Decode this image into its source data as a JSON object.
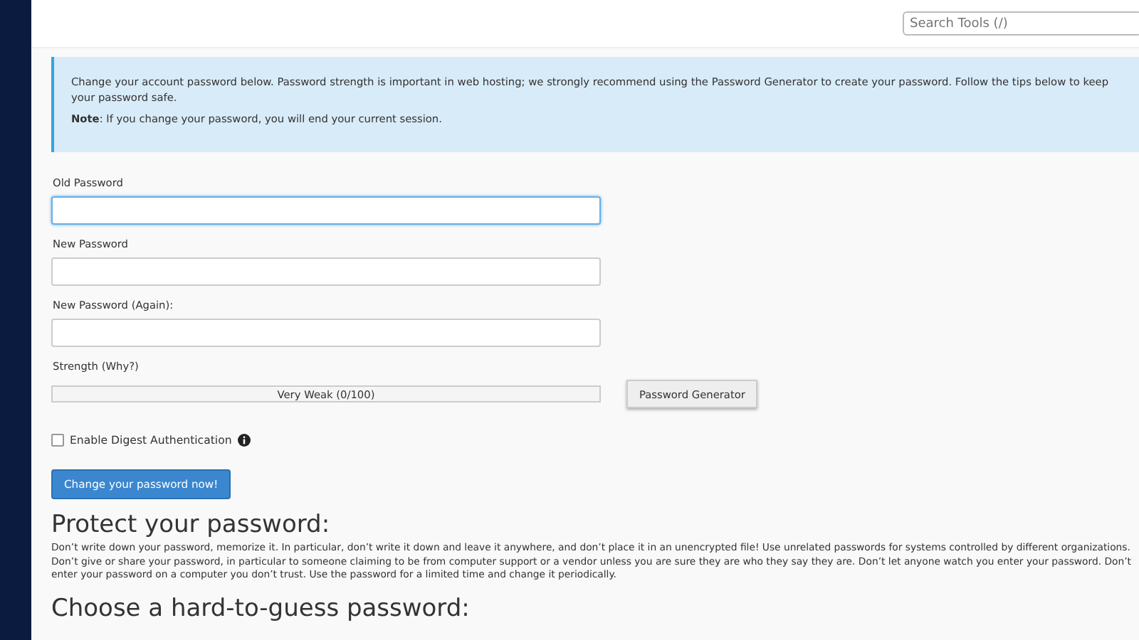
{
  "search": {
    "placeholder": "Search Tools (/)"
  },
  "notice": {
    "text": "Change your account password below. Password strength is important in web hosting; we strongly recommend using the Password Generator to create your password. Follow the tips below to keep your password safe.",
    "note": "**Note**: If you change your password, you will end your current session."
  },
  "fields": [
    {
      "label": "Old Password",
      "focused": true
    },
    {
      "label": "New Password",
      "focused": false
    },
    {
      "label": "New Password (Again):",
      "focused": false
    }
  ],
  "strength": {
    "label": "Strength (Why?)",
    "level": 0,
    "reading": "Very Weak (0/100)",
    "generator_button": "Password Generator"
  },
  "digest": {
    "label": "Enable Digest Authentication",
    "checked": false
  },
  "submit": "Change your password now!",
  "sections": [
    {
      "heading": "Protect your password:",
      "text": "Don’t write down your password, memorize it. In particular, don’t write it down and leave it anywhere, and don’t place it in an unencrypted file! Use unrelated passwords for systems controlled by different organizations. Don’t give or share your password, in particular to someone claiming to be from computer support or a vendor unless you are sure they are who they say they are. Don’t let anyone watch you enter your password. Don’t enter your password on a computer you don’t trust. Use the password for a limited time and change it periodically."
    },
    {
      "heading": "Choose a hard-to-guess password:"
    }
  ]
}
